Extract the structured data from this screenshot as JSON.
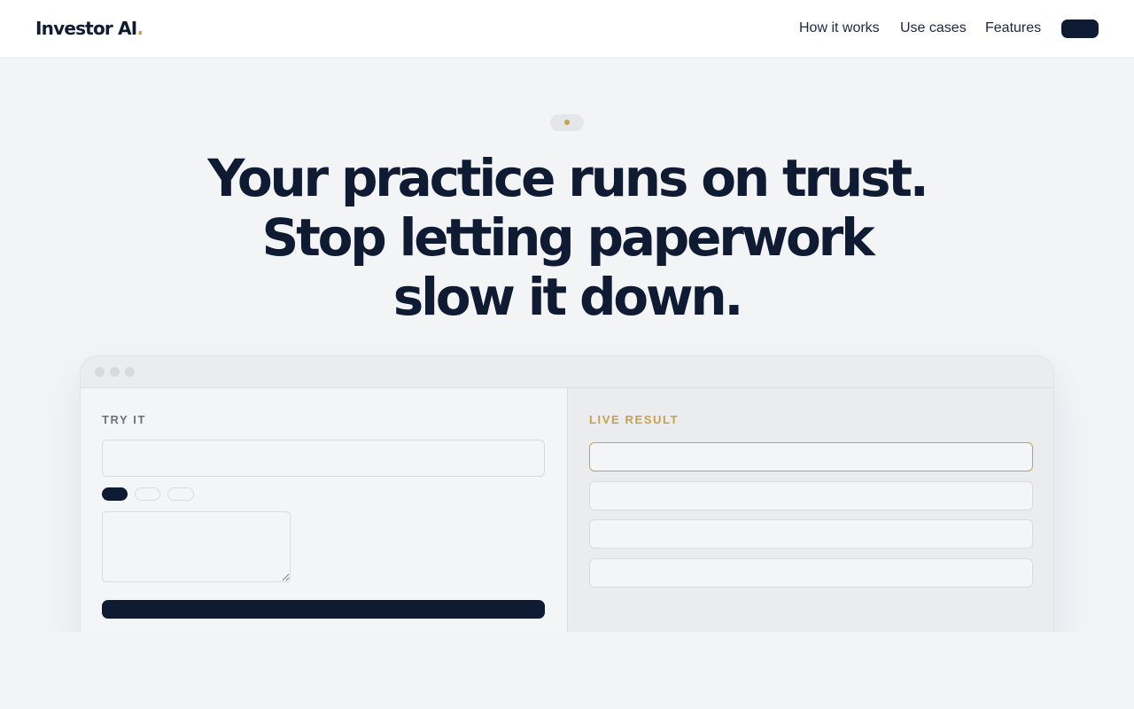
{
  "header": {
    "logo_text": "Investor AI",
    "logo_dot": ".",
    "nav": {
      "how_it_works": "How it works",
      "use_cases": "Use cases",
      "features": "Features"
    }
  },
  "hero": {
    "headline_lines": [
      "Your practice runs on trust.",
      "Stop letting paperwork",
      "slow it down."
    ]
  },
  "demo": {
    "left_label": "TRY IT",
    "right_label": "LIVE RESULT"
  },
  "colors": {
    "navy": "#0f1b33",
    "gold": "#c8a04c",
    "background": "#f3f4f6"
  }
}
